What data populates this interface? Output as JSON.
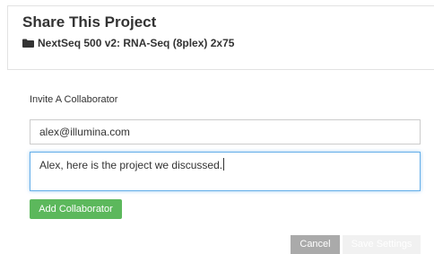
{
  "header": {
    "title": "Share This Project",
    "project_icon": "folder-icon",
    "project_name": "NextSeq 500 v2: RNA-Seq (8plex) 2x75"
  },
  "invite": {
    "label": "Invite A Collaborator",
    "email_value": "alex@illumina.com",
    "message_value": "Alex, here is the project we discussed.",
    "add_button_label": "Add Collaborator"
  },
  "footer": {
    "cancel_label": "Cancel",
    "save_label": "Save Settings"
  },
  "colors": {
    "add_button": "#5cb85c",
    "cancel_button": "#aaaaaa",
    "save_button_disabled": "#f1f1f1",
    "focus_border": "#66afe9"
  }
}
